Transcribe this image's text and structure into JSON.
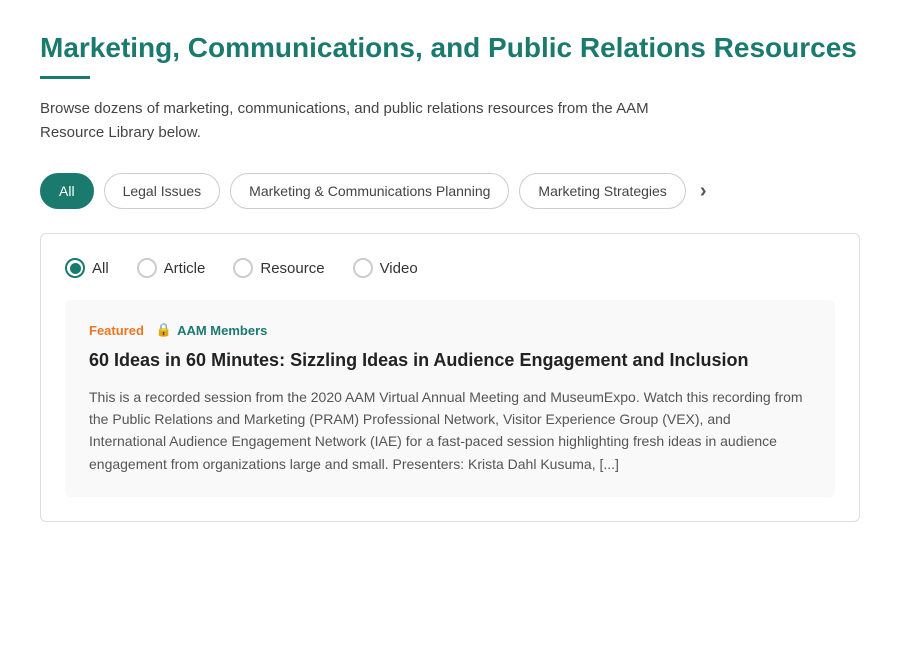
{
  "page": {
    "title": "Marketing, Communications, and Public Relations Resources",
    "underline": true,
    "description": "Browse dozens of marketing, communications, and public relations resources from the AAM Resource Library below."
  },
  "filters": {
    "tabs": [
      {
        "id": "all",
        "label": "All",
        "active": true
      },
      {
        "id": "legal",
        "label": "Legal Issues",
        "active": false
      },
      {
        "id": "marketing-comm",
        "label": "Marketing & Communications Planning",
        "active": false
      },
      {
        "id": "marketing-strat",
        "label": "Marketing Strategies",
        "active": false
      }
    ],
    "chevron_label": "›"
  },
  "radio_group": {
    "options": [
      {
        "id": "all",
        "label": "All",
        "selected": true
      },
      {
        "id": "article",
        "label": "Article",
        "selected": false
      },
      {
        "id": "resource",
        "label": "Resource",
        "selected": false
      },
      {
        "id": "video",
        "label": "Video",
        "selected": false
      }
    ]
  },
  "resource_card": {
    "tag_featured": "Featured",
    "tag_members": "AAM Members",
    "lock_icon": "🔒",
    "title": "60 Ideas in 60 Minutes: Sizzling Ideas in Audience Engagement and Inclusion",
    "body": "This is a recorded session from the 2020 AAM Virtual Annual Meeting and MuseumExpo. Watch this recording from the Public Relations and Marketing (PRAM) Professional Network, Visitor Experience Group (VEX), and International Audience Engagement Network (IAE) for a fast-paced session highlighting fresh ideas in audience engagement from organizations large and small. Presenters: Krista Dahl Kusuma, [...]"
  }
}
